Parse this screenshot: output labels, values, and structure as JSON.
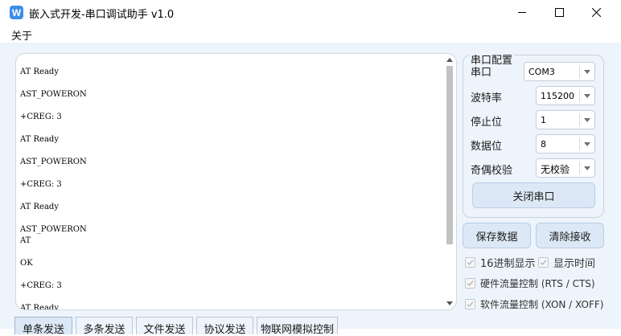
{
  "window": {
    "icon_letter": "W",
    "title": "嵌入式开发-串口调试助手 v1.0"
  },
  "menu": {
    "about": "关于"
  },
  "receive": {
    "lines": [
      "AT Ready",
      "",
      "AST_POWERON",
      "",
      "+CREG: 3",
      "",
      "AT Ready",
      "",
      "AST_POWERON",
      "",
      "+CREG: 3",
      "",
      "AT Ready",
      "",
      "AST_POWERON",
      "AT",
      "",
      "OK",
      "",
      "+CREG: 3",
      "",
      "AT Ready"
    ]
  },
  "tabs": [
    "单条发送",
    "多条发送",
    "文件发送",
    "协议发送",
    "物联网模拟控制"
  ],
  "serial_config": {
    "group_title": "串口配置",
    "port_label": "串口",
    "port_value": "COM3",
    "baud_label": "波特率",
    "baud_value": "115200",
    "stopbits_label": "停止位",
    "stopbits_value": "1",
    "databits_label": "数据位",
    "databits_value": "8",
    "parity_label": "奇偶校验",
    "parity_value": "无校验",
    "close_port_button": "关闭串口"
  },
  "actions": {
    "save_data": "保存数据",
    "clear_receive": "清除接收"
  },
  "options": {
    "hex_display": "16进制显示",
    "show_time": "显示时间",
    "hw_flow": "硬件流量控制 (RTS / CTS)",
    "sw_flow": "软件流量控制 (XON / XOFF)"
  }
}
